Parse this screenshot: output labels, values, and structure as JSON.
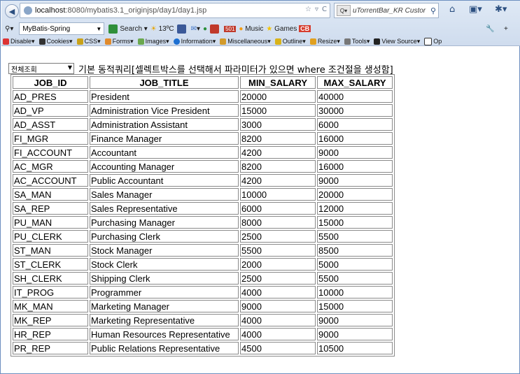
{
  "browser": {
    "url_host": "localhost",
    "url_path": ":8080/mybatis3.1_originjsp/day1/day1.jsp",
    "search_placeholder": "uTorrentBar_KR Custor",
    "toolbar": {
      "profile": "MyBatis-Spring",
      "search_label": "Search",
      "weather": "13ºC",
      "badge": "501",
      "music_label": "Music",
      "games_label": "Games",
      "games_badge": "CB"
    },
    "webdev": [
      "Disable▾",
      "Cookies▾",
      "CSS▾",
      "Forms▾",
      "Images▾",
      "Information▾",
      "Miscellaneous▾",
      "Outline▾",
      "Resize▾",
      "Tools▾",
      "View Source▾",
      "Op"
    ]
  },
  "page": {
    "select_value": "전체조회",
    "description": "기본 동적쿼리[셀렉트박스를 선택해서 파라미터가 있으면 where 조건절을 생성함]",
    "headers": [
      "JOB_ID",
      "JOB_TITLE",
      "MIN_SALARY",
      "MAX_SALARY"
    ],
    "rows": [
      [
        "AD_PRES",
        "President",
        "20000",
        "40000"
      ],
      [
        "AD_VP",
        "Administration Vice President",
        "15000",
        "30000"
      ],
      [
        "AD_ASST",
        "Administration Assistant",
        "3000",
        "6000"
      ],
      [
        "FI_MGR",
        "Finance Manager",
        "8200",
        "16000"
      ],
      [
        "FI_ACCOUNT",
        "Accountant",
        "4200",
        "9000"
      ],
      [
        "AC_MGR",
        "Accounting Manager",
        "8200",
        "16000"
      ],
      [
        "AC_ACCOUNT",
        "Public Accountant",
        "4200",
        "9000"
      ],
      [
        "SA_MAN",
        "Sales Manager",
        "10000",
        "20000"
      ],
      [
        "SA_REP",
        "Sales Representative",
        "6000",
        "12000"
      ],
      [
        "PU_MAN",
        "Purchasing Manager",
        "8000",
        "15000"
      ],
      [
        "PU_CLERK",
        "Purchasing Clerk",
        "2500",
        "5500"
      ],
      [
        "ST_MAN",
        "Stock Manager",
        "5500",
        "8500"
      ],
      [
        "ST_CLERK",
        "Stock Clerk",
        "2000",
        "5000"
      ],
      [
        "SH_CLERK",
        "Shipping Clerk",
        "2500",
        "5500"
      ],
      [
        "IT_PROG",
        "Programmer",
        "4000",
        "10000"
      ],
      [
        "MK_MAN",
        "Marketing Manager",
        "9000",
        "15000"
      ],
      [
        "MK_REP",
        "Marketing Representative",
        "4000",
        "9000"
      ],
      [
        "HR_REP",
        "Human Resources Representative",
        "4000",
        "9000"
      ],
      [
        "PR_REP",
        "Public Relations Representative",
        "4500",
        "10500"
      ]
    ]
  }
}
